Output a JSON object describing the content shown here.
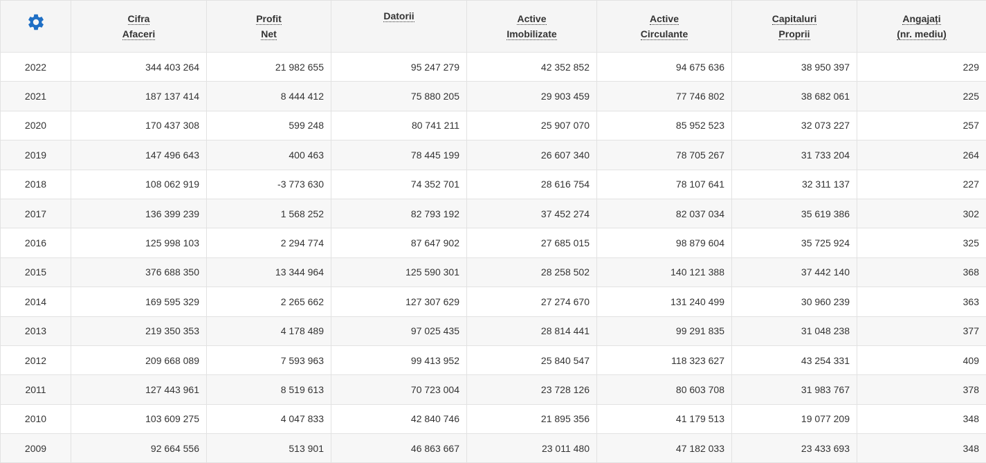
{
  "accent_color": "#1f6fc5",
  "settings_icon": "gear-icon",
  "headers": [
    {
      "line1": "Cifra",
      "line2": "Afaceri"
    },
    {
      "line1": "Profit",
      "line2": "Net"
    },
    {
      "line1": "Datorii",
      "line2": ""
    },
    {
      "line1": "Active",
      "line2": "Imobilizate"
    },
    {
      "line1": "Active",
      "line2": "Circulante"
    },
    {
      "line1": "Capitaluri",
      "line2": "Proprii"
    },
    {
      "line1": "Angajați",
      "line2": "(nr. mediu)"
    }
  ],
  "rows": [
    [
      "2022",
      "344 403 264",
      "21 982 655",
      "95 247 279",
      "42 352 852",
      "94 675 636",
      "38 950 397",
      "229"
    ],
    [
      "2021",
      "187 137 414",
      "8 444 412",
      "75 880 205",
      "29 903 459",
      "77 746 802",
      "38 682 061",
      "225"
    ],
    [
      "2020",
      "170 437 308",
      "599 248",
      "80 741 211",
      "25 907 070",
      "85 952 523",
      "32 073 227",
      "257"
    ],
    [
      "2019",
      "147 496 643",
      "400 463",
      "78 445 199",
      "26 607 340",
      "78 705 267",
      "31 733 204",
      "264"
    ],
    [
      "2018",
      "108 062 919",
      "-3 773 630",
      "74 352 701",
      "28 616 754",
      "78 107 641",
      "32 311 137",
      "227"
    ],
    [
      "2017",
      "136 399 239",
      "1 568 252",
      "82 793 192",
      "37 452 274",
      "82 037 034",
      "35 619 386",
      "302"
    ],
    [
      "2016",
      "125 998 103",
      "2 294 774",
      "87 647 902",
      "27 685 015",
      "98 879 604",
      "35 725 924",
      "325"
    ],
    [
      "2015",
      "376 688 350",
      "13 344 964",
      "125 590 301",
      "28 258 502",
      "140 121 388",
      "37 442 140",
      "368"
    ],
    [
      "2014",
      "169 595 329",
      "2 265 662",
      "127 307 629",
      "27 274 670",
      "131 240 499",
      "30 960 239",
      "363"
    ],
    [
      "2013",
      "219 350 353",
      "4 178 489",
      "97 025 435",
      "28 814 441",
      "99 291 835",
      "31 048 238",
      "377"
    ],
    [
      "2012",
      "209 668 089",
      "7 593 963",
      "99 413 952",
      "25 840 547",
      "118 323 627",
      "43 254 331",
      "409"
    ],
    [
      "2011",
      "127 443 961",
      "8 519 613",
      "70 723 004",
      "23 728 126",
      "80 603 708",
      "31 983 767",
      "378"
    ],
    [
      "2010",
      "103 609 275",
      "4 047 833",
      "42 840 746",
      "21 895 356",
      "41 179 513",
      "19 077 209",
      "348"
    ],
    [
      "2009",
      "92 664 556",
      "513 901",
      "46 863 667",
      "23 011 480",
      "47 182 033",
      "23 433 693",
      "348"
    ]
  ]
}
